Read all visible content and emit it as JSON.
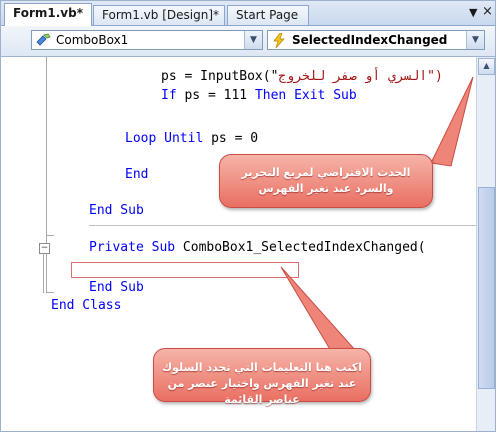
{
  "tabs": [
    {
      "label": "Form1.vb*",
      "active": true
    },
    {
      "label": "Form1.vb [Design]*",
      "active": false
    },
    {
      "label": "Start Page",
      "active": false
    }
  ],
  "tab_controls": {
    "dropdown_glyph": "▼",
    "close_glyph": "×"
  },
  "object_dropdown": {
    "value": "ComboBox1",
    "icon": "component-icon"
  },
  "event_dropdown": {
    "value": "SelectedIndexChanged",
    "icon": "lightning-icon"
  },
  "code": {
    "line1_kw": "ps = InputBox(\"",
    "line1_str": "السري أو صفر للخروج\")",
    "line2_if": "If",
    "line2_mid": " ps = 111 ",
    "line2_then": "Then Exit Sub",
    "line3_loop": "Loop Until",
    "line3_rest": " ps = 0",
    "line4_end": "End",
    "line5_endsub": "End Sub",
    "line6_private": "Private Sub",
    "line6_rest": " ComboBox1_SelectedIndexChanged(",
    "line7_endsub": "End Sub",
    "line8_endclass": "End Class"
  },
  "callouts": {
    "top": "الحدث الافتراضي لمربع التحرير والسرد عند تغير الفهرس",
    "bottom": "اكتب هنا التعليمات التي تحدد السلوك عند تغير الفهرس واختيار عنصر من عناصر القائمة"
  },
  "colors": {
    "keyword": "#0000ff",
    "callout": "#e96f62",
    "edit_box_border": "#e07070"
  }
}
